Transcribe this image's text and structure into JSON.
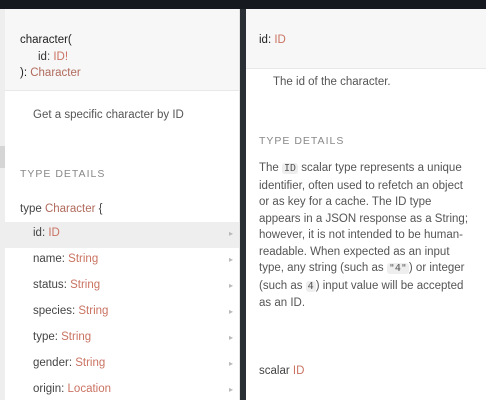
{
  "left": {
    "signature": {
      "field_name": "character(",
      "arg_name": "id",
      "arg_sep": ": ",
      "arg_type": "ID!",
      "close": "): ",
      "return_type": "Character"
    },
    "description": "Get a specific character by ID",
    "type_details_title": "TYPE DETAILS",
    "type_keyword": "type ",
    "type_name": "Character",
    "type_brace": " {",
    "fields": [
      {
        "name": "id",
        "type": "ID",
        "selected": true
      },
      {
        "name": "name",
        "type": "String",
        "selected": false
      },
      {
        "name": "status",
        "type": "String",
        "selected": false
      },
      {
        "name": "species",
        "type": "String",
        "selected": false
      },
      {
        "name": "type",
        "type": "String",
        "selected": false
      },
      {
        "name": "gender",
        "type": "String",
        "selected": false
      },
      {
        "name": "origin",
        "type": "Location",
        "selected": false
      }
    ],
    "field_sep": ": ",
    "arrow_glyph": "▸"
  },
  "right": {
    "title_name": "id",
    "title_sep": ": ",
    "title_type": "ID",
    "description": "The id of the character.",
    "type_details_title": "TYPE DETAILS",
    "body": {
      "p1": "The ",
      "c1": "ID",
      "p2": " scalar type represents a unique identifier, often used to refetch an object or as key for a cache. The ID type appears in a JSON response as a String; however, it is not intended to be human-readable. When expected as an input type, any string (such as ",
      "c2": "\"4\"",
      "p3": ") or integer (such as ",
      "c3": "4",
      "p4": ") input value will be accepted as an ID."
    },
    "scalar_keyword": "scalar ",
    "scalar_type": "ID"
  },
  "colors": {
    "type_accent": "#ca7362",
    "selected_row": "#eeeeee",
    "header_bg": "#f7f7f7"
  }
}
